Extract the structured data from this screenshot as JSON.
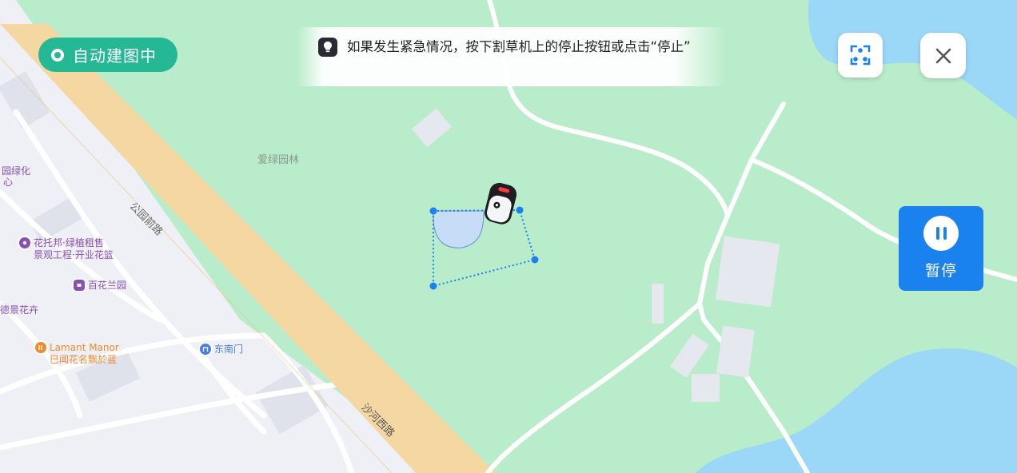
{
  "status": {
    "label": "自动建图中"
  },
  "tip": {
    "text": "如果发生紧急情况，按下割草机上的停止按钮或点击“停止”"
  },
  "controls": {
    "pause_label": "暂停",
    "scan_icon": "scan-recenter-icon",
    "close_icon": "close-icon"
  },
  "map": {
    "area_label": "爱绿园林",
    "roads": [
      "公园前路",
      "沙河西路"
    ],
    "side_labels": [
      "园绿化",
      "心",
      "德景花卉"
    ],
    "pois": [
      {
        "line1": "花托邦·绿植租售",
        "line2": "景观工程·开业花篮",
        "color": "#8a4fb4"
      },
      {
        "line1": "百花兰园",
        "line2": "",
        "color": "#8a4fb4"
      },
      {
        "line1": "Lamant Manor",
        "line2": "巳闻花名飘於蓝",
        "color": "#f08a2e"
      },
      {
        "line1": "东南门",
        "line2": "",
        "color": "#4a7fe0"
      }
    ]
  },
  "colors": {
    "grass": "#b9ecca",
    "water": "#9bd7f7",
    "major_road": "#f5d7a2",
    "urban": "#eef0f6",
    "accent_green": "#24b994",
    "accent_blue": "#1a82ee"
  }
}
